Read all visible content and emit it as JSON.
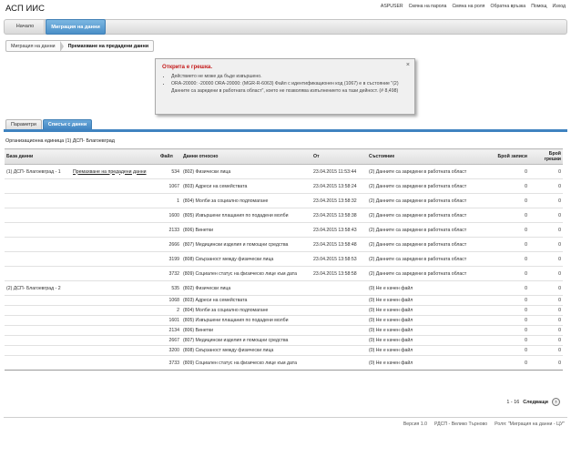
{
  "app": {
    "title": "АСП ИИС"
  },
  "top_links": [
    "ASPUSER",
    "Смяна на парола",
    "Смяна на роля",
    "Обратна връзка",
    "Помощ",
    "Изход"
  ],
  "nav": {
    "home": "Начало",
    "active": "Миграция на данни"
  },
  "breadcrumb": {
    "parent": "Миграция на данни",
    "current": "Премахване на предадени данни"
  },
  "error": {
    "title": "Открита е грешка.",
    "close": "×",
    "messages": [
      "Действието не може да бъде извършено.",
      "ORA-20000: -20000 ORA-20000: (MGR-R-6063) Файл с идентификационен код (1067) е в състояние \"(2) Данните са заредени в работната област\", което не позволява изпълнението на тази дейност. (# 8,498)"
    ]
  },
  "subtabs": {
    "params": "Параметри",
    "list": "Списък с данни"
  },
  "org_label": "Организационна единица (1) ДСП- Благоевград",
  "table": {
    "headers": {
      "db": "База данни",
      "file": "Файл",
      "data": "Данни относно",
      "from": "От",
      "state": "Състояние",
      "records": "Брой записи",
      "errors": "Брой грешки"
    },
    "rows": [
      {
        "db": "(1) ДСП- Благоевград - 1",
        "action": "Премахване на предадени данни",
        "file": "534",
        "data": "(802) Физически лица",
        "from": "23.04.2015 11:53:44",
        "state": "(2) Данните са заредени в работната област",
        "records": "0",
        "errors": "0"
      },
      {
        "db": "",
        "action": "",
        "file": "1067",
        "data": "(803) Адреси на семействата",
        "from": "23.04.2015 13:58:24",
        "state": "(2) Данните са заредени в работната област",
        "records": "0",
        "errors": "0"
      },
      {
        "db": "",
        "action": "",
        "file": "1",
        "data": "(804) Молби за социално подпомагане",
        "from": "23.04.2015 13:58:32",
        "state": "(2) Данните са заредени в работната област",
        "records": "0",
        "errors": "0"
      },
      {
        "db": "",
        "action": "",
        "file": "1600",
        "data": "(805) Извършени плащания по подадени молби",
        "from": "23.04.2015 13:58:38",
        "state": "(2) Данните са заредени в работната област",
        "records": "0",
        "errors": "0"
      },
      {
        "db": "",
        "action": "",
        "file": "2133",
        "data": "(806) Винетки",
        "from": "23.04.2015 13:58:43",
        "state": "(2) Данните са заредени в работната област",
        "records": "0",
        "errors": "0"
      },
      {
        "db": "",
        "action": "",
        "file": "2666",
        "data": "(807) Медицински изделия и помощни средства",
        "from": "23.04.2015 13:58:48",
        "state": "(2) Данните са заредени в работната област",
        "records": "0",
        "errors": "0"
      },
      {
        "db": "",
        "action": "",
        "file": "3199",
        "data": "(808) Свързаност между физически лица",
        "from": "23.04.2015 13:58:53",
        "state": "(2) Данните са заредени в работната област",
        "records": "0",
        "errors": "0"
      },
      {
        "db": "",
        "action": "",
        "file": "3732",
        "data": "(809) Социален статус на физическо лице към дата",
        "from": "23.04.2015 13:58:58",
        "state": "(2) Данните са заредени в работната област",
        "records": "0",
        "errors": "0"
      },
      {
        "db": "(2) ДСП- Благоевград - 2",
        "action": "",
        "file": "535",
        "data": "(802) Физически лица",
        "from": "",
        "state": "(0) Не е качен файл",
        "records": "0",
        "errors": "0"
      },
      {
        "db": "",
        "action": "",
        "file": "1068",
        "data": "(803) Адреси на семействата",
        "from": "",
        "state": "(0) Не е качен файл",
        "records": "0",
        "errors": "0"
      },
      {
        "db": "",
        "action": "",
        "file": "2",
        "data": "(804) Молби за социално подпомагане",
        "from": "",
        "state": "(0) Не е качен файл",
        "records": "0",
        "errors": "0"
      },
      {
        "db": "",
        "action": "",
        "file": "1601",
        "data": "(805) Извършени плащания по подадени молби",
        "from": "",
        "state": "(0) Не е качен файл",
        "records": "0",
        "errors": "0"
      },
      {
        "db": "",
        "action": "",
        "file": "2134",
        "data": "(806) Винетки",
        "from": "",
        "state": "(0) Не е качен файл",
        "records": "0",
        "errors": "0"
      },
      {
        "db": "",
        "action": "",
        "file": "2667",
        "data": "(807) Медицински изделия и помощни средства",
        "from": "",
        "state": "(0) Не е качен файл",
        "records": "0",
        "errors": "0"
      },
      {
        "db": "",
        "action": "",
        "file": "3200",
        "data": "(808) Свързаност между физически лица",
        "from": "",
        "state": "(0) Не е качен файл",
        "records": "0",
        "errors": "0"
      },
      {
        "db": "",
        "action": "",
        "file": "3733",
        "data": "(809) Социален статус на физическо лице към дата",
        "from": "",
        "state": "(0) Не е качен файл",
        "records": "0",
        "errors": "0"
      }
    ]
  },
  "pager": {
    "range": "1 - 16",
    "next": "Следващи"
  },
  "footer": {
    "version": "Версия 1.0",
    "office": "РДСП - Велико Търново",
    "role": "Роля: \"Миграция на данни - ЦУ\""
  }
}
